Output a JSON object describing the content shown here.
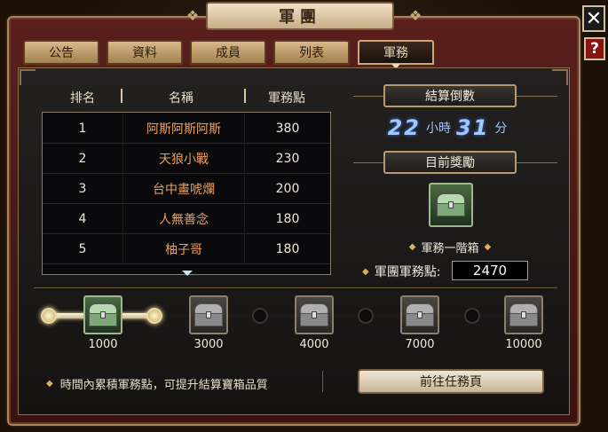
{
  "window": {
    "title": "軍團"
  },
  "buttons": {
    "close": "✕",
    "help": "?"
  },
  "tabs": [
    "公告",
    "資料",
    "成員",
    "列表",
    "軍務"
  ],
  "active_tab": 4,
  "table": {
    "headers": {
      "rank": "排名",
      "name": "名稱",
      "points": "軍務點"
    },
    "rows": [
      {
        "rank": "1",
        "name": "阿斯阿斯阿斯",
        "points": "380"
      },
      {
        "rank": "2",
        "name": "天狼小戰",
        "points": "230"
      },
      {
        "rank": "3",
        "name": "台中畫唬爛",
        "points": "200"
      },
      {
        "rank": "4",
        "name": "人無善念",
        "points": "180"
      },
      {
        "rank": "5",
        "name": "柚子哥",
        "points": "180"
      }
    ]
  },
  "settlement": {
    "countdown_label": "結算倒數",
    "hours": "22",
    "hours_unit": "小時",
    "minutes": "31",
    "minutes_unit": "分",
    "reward_label": "目前獎勵",
    "reward_name": "軍務一階箱",
    "legion_points_label": "軍團軍務點:",
    "legion_points": "2470"
  },
  "milestones": {
    "progress_points": 2470,
    "items": [
      {
        "value": "1000",
        "unlocked": true
      },
      {
        "value": "3000",
        "unlocked": false
      },
      {
        "value": "4000",
        "unlocked": false
      },
      {
        "value": "7000",
        "unlocked": false
      },
      {
        "value": "10000",
        "unlocked": false
      }
    ]
  },
  "footer": {
    "hint": "時間內累積軍務點，可提升結算寶箱品質",
    "go_button": "前往任務頁"
  },
  "colors": {
    "accent_gold": "#b89a70",
    "name_orange": "#e8a060",
    "countdown_blue": "#9ec8ff",
    "frame_red": "#5a1f1c"
  },
  "icons": {
    "close": "close-icon",
    "help": "help-icon",
    "chest": "treasure-chest-icon",
    "diamond": "diamond-bullet-icon"
  }
}
